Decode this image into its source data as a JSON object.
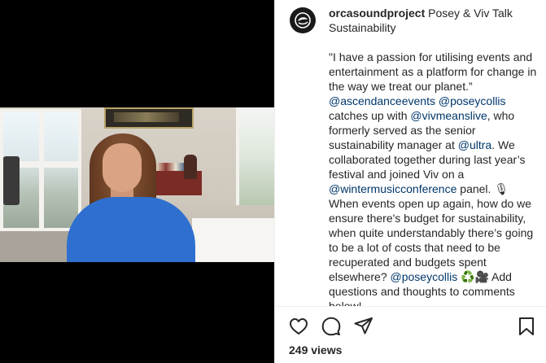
{
  "post": {
    "username": "orcasoundproject",
    "caption_parts": [
      {
        "type": "text",
        "text": " Posey & Viv Talk Sustainability\n\n\"I have a passion for utilising events and entertainment as a platform for change in the way we treat our planet.” "
      },
      {
        "type": "mention",
        "text": "@ascendanceevents"
      },
      {
        "type": "text",
        "text": " "
      },
      {
        "type": "mention",
        "text": "@poseycollis"
      },
      {
        "type": "text",
        "text": " catches up with "
      },
      {
        "type": "mention",
        "text": "@vivmeanslive"
      },
      {
        "type": "text",
        "text": ", who formerly served as the senior sustainability manager at "
      },
      {
        "type": "mention",
        "text": "@ultra"
      },
      {
        "type": "text",
        "text": ". We collaborated together during last year’s festival and joined Viv on a "
      },
      {
        "type": "mention",
        "text": "@wintermusicconference"
      },
      {
        "type": "text",
        "text": " panel. 🎙 When events open up again, how do we ensure there's budget for sustainability, when quite understandably there’s going to be a lot of costs that need to be recuperated and budgets spent elsewhere? "
      },
      {
        "type": "mention",
        "text": "@poseycollis"
      },
      {
        "type": "text",
        "text": " ♻️🎥 Add questions and thoughts to comments below!"
      }
    ],
    "views_text": "249 views"
  },
  "icons": {
    "avatar": "orca-sound-logo-icon",
    "like": "heart-icon",
    "comment": "comment-bubble-icon",
    "share": "paper-plane-icon",
    "save": "bookmark-icon"
  },
  "colors": {
    "mention": "#00376b",
    "text": "#262626"
  }
}
